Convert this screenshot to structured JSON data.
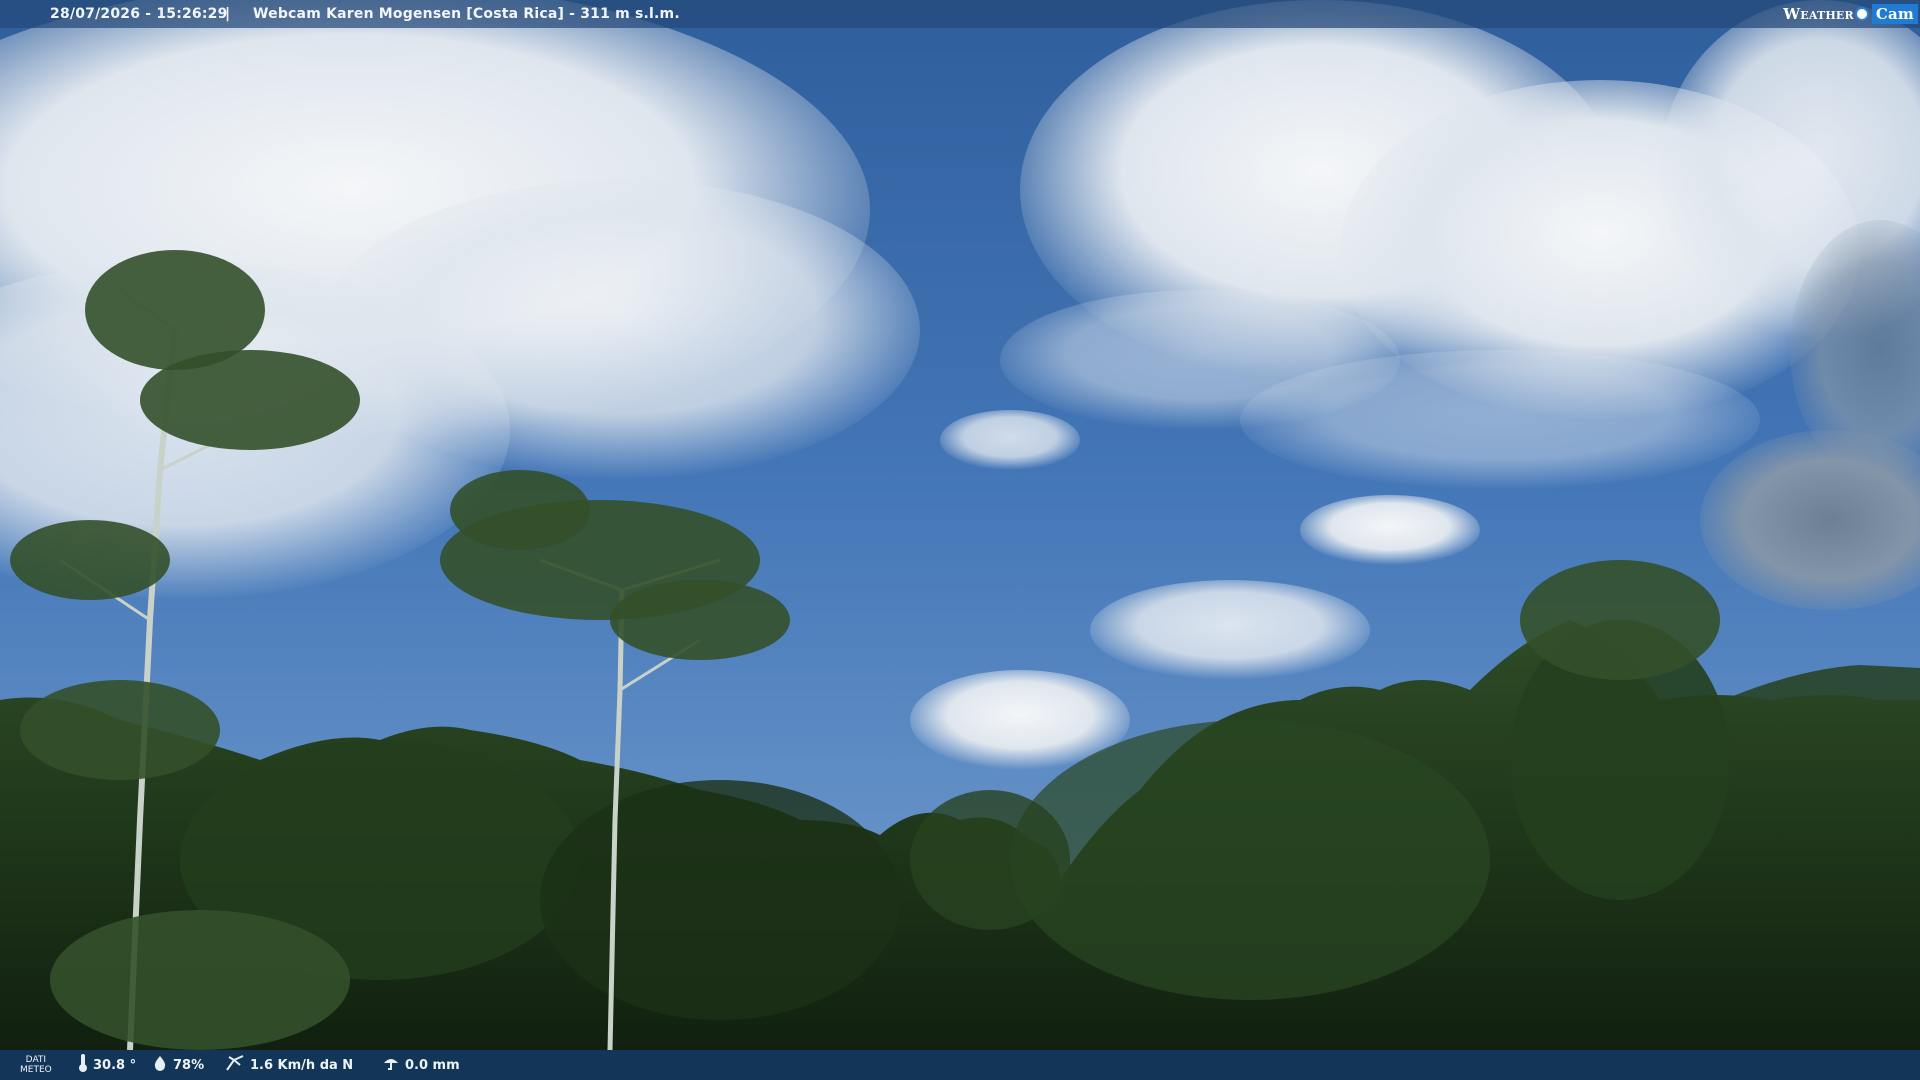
{
  "header": {
    "timestamp": "28/07/2026 - 15:26:29",
    "separator": "|",
    "location": "Webcam Karen Mogensen [Costa Rica]  - 311 m s.l.m.",
    "brand_weather": "Weather",
    "brand_cam": "Cam"
  },
  "footer": {
    "label_line1": "DATI",
    "label_line2": "METEO",
    "temperature": "30.8 °",
    "humidity": "78%",
    "wind": "1.6 Km/h da N",
    "rain": "0.0 mm",
    "icons": [
      "thermometer-icon",
      "humidity-drop-icon",
      "wind-icon",
      "rain-gauge-icon"
    ]
  },
  "colors": {
    "sky_top": "#2f5f9e",
    "sky_mid": "#4a7fc0",
    "foliage_dark": "#152a14",
    "foliage_mid": "#2c4a22",
    "bar": "#1e4a7c",
    "brand_accent": "#1f7bd3"
  }
}
